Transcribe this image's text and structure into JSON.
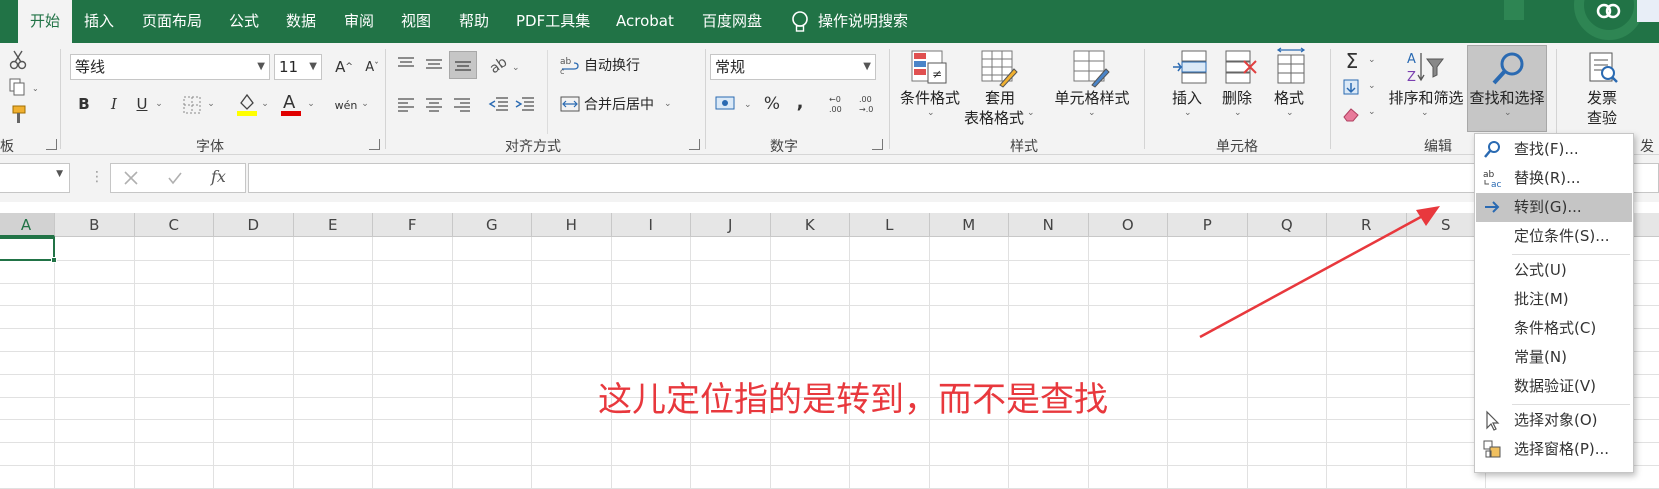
{
  "tabs": [
    {
      "label": "开始",
      "active": true
    },
    {
      "label": "插入"
    },
    {
      "label": "页面布局"
    },
    {
      "label": "公式"
    },
    {
      "label": "数据"
    },
    {
      "label": "审阅"
    },
    {
      "label": "视图"
    },
    {
      "label": "帮助"
    },
    {
      "label": "PDF工具集"
    },
    {
      "label": "Acrobat"
    },
    {
      "label": "百度网盘"
    }
  ],
  "tell_me": "操作说明搜索",
  "ribbon": {
    "clipboard_label": "板",
    "font": {
      "name": "等线",
      "size": "11",
      "group_label": "字体",
      "bold": "B",
      "italic": "I",
      "underline": "U",
      "phonetic": "wén"
    },
    "alignment": {
      "wrap_text": "自动换行",
      "merge_center": "合并后居中",
      "group_label": "对齐方式"
    },
    "number": {
      "format": "常规",
      "percent": "%",
      "comma": ",",
      "group_label": "数字"
    },
    "styles": {
      "conditional": "条件格式",
      "table_format_1": "套用",
      "table_format_2": "表格格式",
      "cell_styles": "单元格样式",
      "group_label": "样式"
    },
    "cells": {
      "insert": "插入",
      "delete": "删除",
      "format": "格式",
      "group_label": "单元格"
    },
    "editing": {
      "sort_filter": "排序和筛选",
      "find_select": "查找和选择",
      "group_label": "编辑"
    },
    "invoice": {
      "label_1": "发票",
      "label_2": "查验",
      "group_label_partial": "发"
    }
  },
  "formula_bar": {
    "name_box": "",
    "fx": "fx",
    "content": ""
  },
  "columns": [
    "A",
    "B",
    "C",
    "D",
    "E",
    "F",
    "G",
    "H",
    "I",
    "J",
    "K",
    "L",
    "M",
    "N",
    "O",
    "P",
    "Q",
    "R",
    "S"
  ],
  "annotation": "这儿定位指的是转到，而不是查找",
  "menu": {
    "items": [
      {
        "label": "查找(F)...",
        "icon": "search-icon"
      },
      {
        "label": "替换(R)...",
        "icon": "replace-icon"
      },
      {
        "label": "转到(G)...",
        "icon": "arrow-right-icon",
        "highlighted": true
      },
      {
        "label": "定位条件(S)..."
      },
      {
        "label": "公式(U)"
      },
      {
        "label": "批注(M)"
      },
      {
        "label": "条件格式(C)"
      },
      {
        "label": "常量(N)"
      },
      {
        "label": "数据验证(V)"
      },
      {
        "label": "选择对象(O)",
        "icon": "cursor-icon"
      },
      {
        "label": "选择窗格(P)...",
        "icon": "selection-pane-icon"
      }
    ]
  },
  "colors": {
    "accent": "#217346",
    "annotation": "#e8383d",
    "highlight": "#c5c5c5"
  }
}
